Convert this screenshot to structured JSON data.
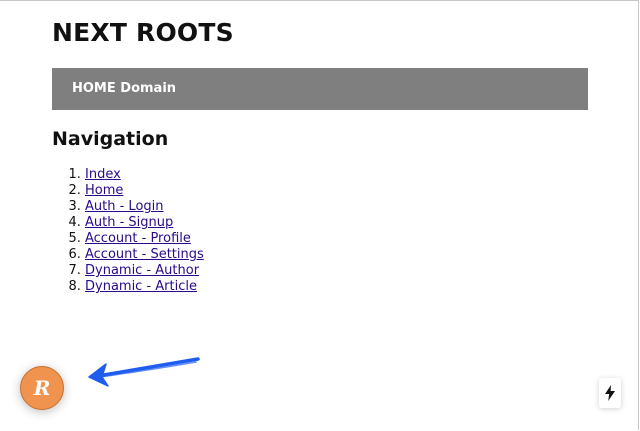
{
  "site": {
    "title": "NEXT ROOTS",
    "domain_label": "HOME Domain"
  },
  "navigation": {
    "heading": "Navigation",
    "items": [
      {
        "label": "Index"
      },
      {
        "label": "Home"
      },
      {
        "label": "Auth - Login"
      },
      {
        "label": "Auth - Signup"
      },
      {
        "label": "Account - Profile"
      },
      {
        "label": "Account - Settings"
      },
      {
        "label": "Dynamic - Author"
      },
      {
        "label": "Dynamic - Article"
      }
    ]
  },
  "floating_button": {
    "letter": "R",
    "icon": "r-logo-icon",
    "color": "#f0934f"
  },
  "annotation": {
    "icon": "blue-arrow-icon",
    "color": "#1f5cf0"
  },
  "corner_badge": {
    "icon": "lightning-bolt-icon"
  }
}
